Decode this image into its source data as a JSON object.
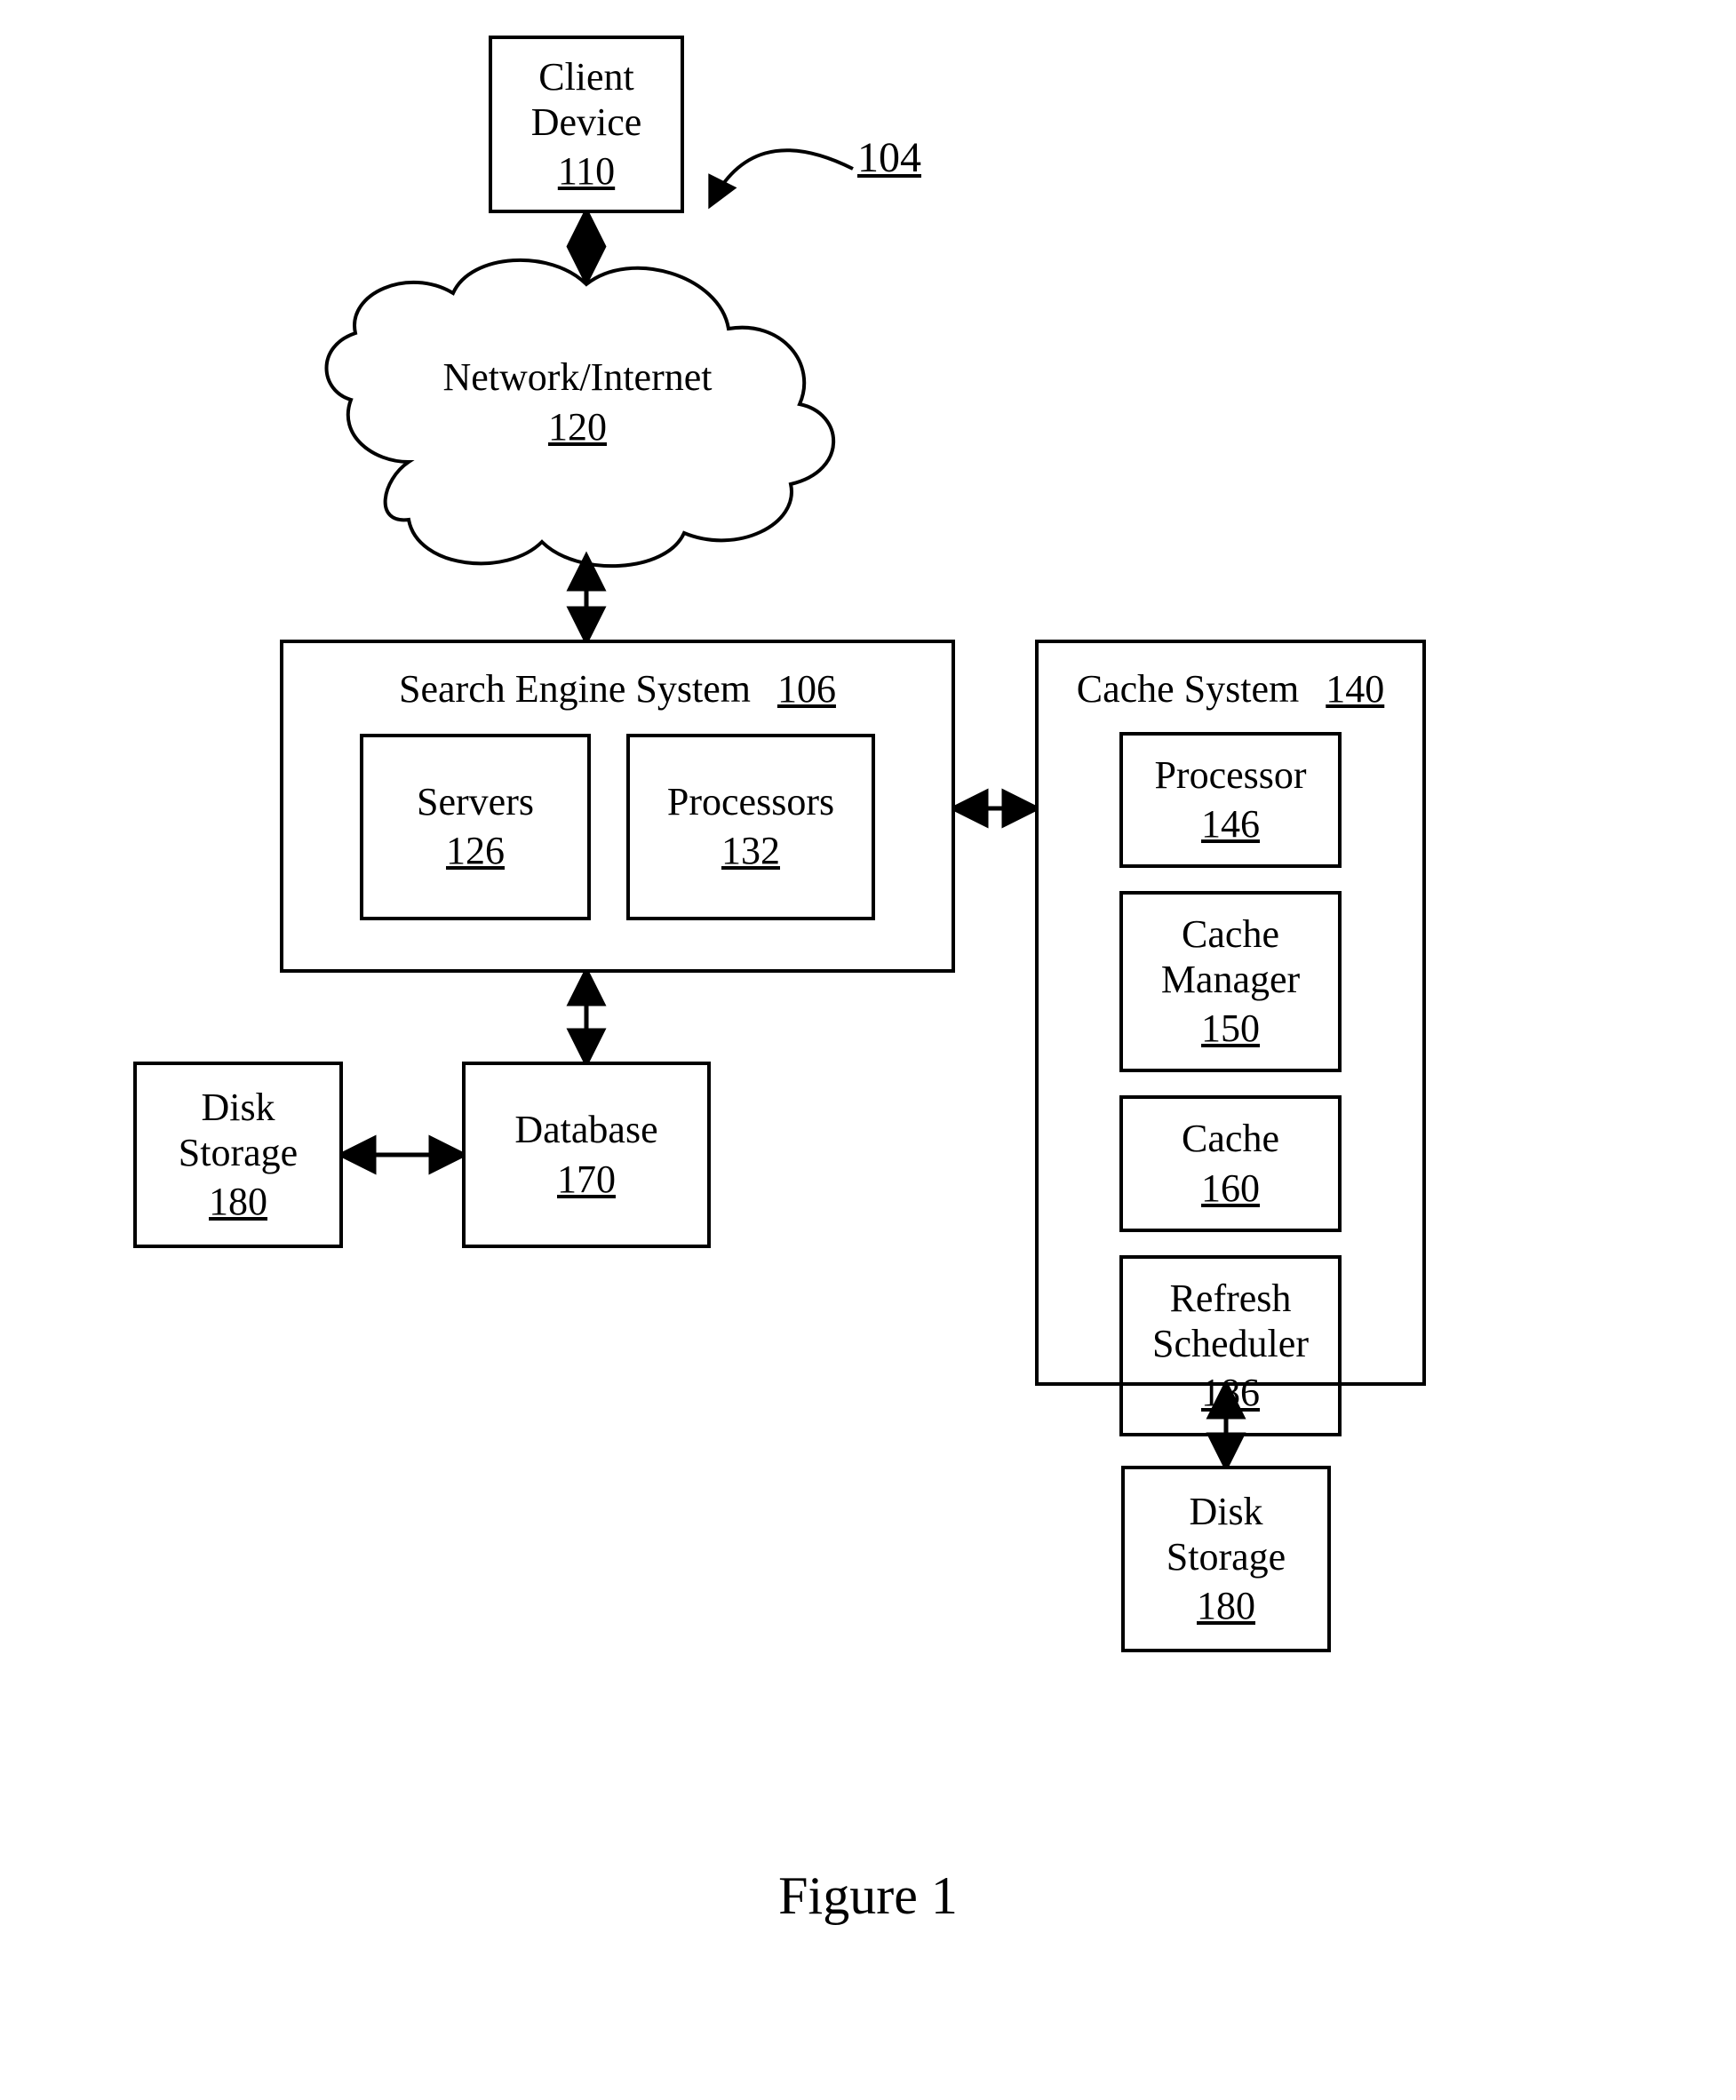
{
  "figure_caption": "Figure 1",
  "callout_ref": "104",
  "nodes": {
    "client_device": {
      "label": "Client Device",
      "ref": "110"
    },
    "network": {
      "label": "Network/Internet",
      "ref": "120"
    },
    "search_engine": {
      "label": "Search Engine System",
      "ref": "106"
    },
    "servers": {
      "label": "Servers",
      "ref": "126"
    },
    "processors": {
      "label": "Processors",
      "ref": "132"
    },
    "cache_system": {
      "label": "Cache System",
      "ref": "140"
    },
    "processor": {
      "label": "Processor",
      "ref": "146"
    },
    "cache_manager": {
      "label": "Cache Manager",
      "ref": "150"
    },
    "cache": {
      "label": "Cache",
      "ref": "160"
    },
    "refresh_sched": {
      "label": "Refresh Scheduler",
      "ref": "186"
    },
    "database": {
      "label": "Database",
      "ref": "170"
    },
    "disk_storage_left": {
      "label": "Disk Storage",
      "ref": "180"
    },
    "disk_storage_right": {
      "label": "Disk Storage",
      "ref": "180"
    }
  }
}
